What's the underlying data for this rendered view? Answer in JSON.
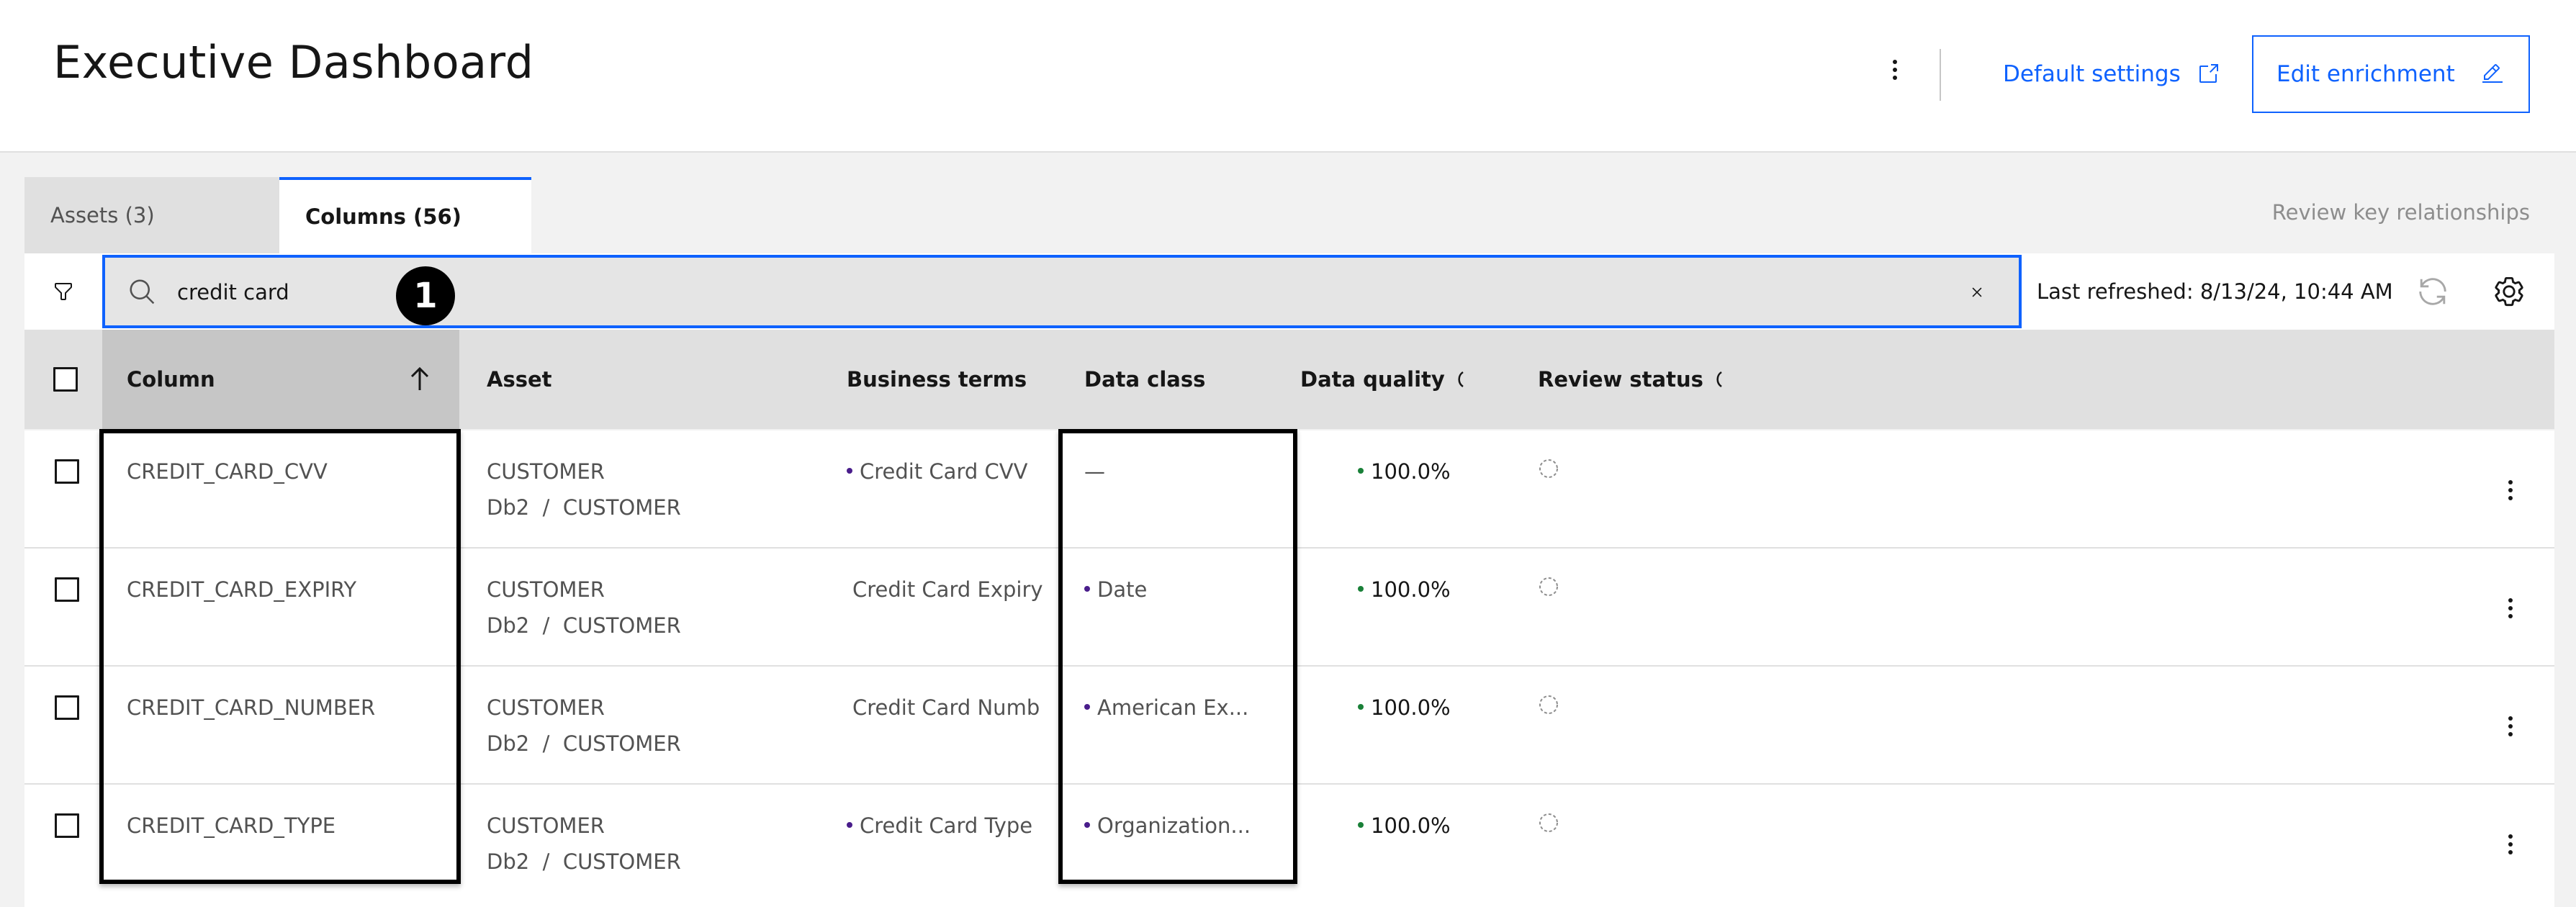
{
  "header": {
    "title": "Executive Dashboard",
    "default_settings_label": "Default settings",
    "edit_enrichment_label": "Edit enrichment"
  },
  "tabs": [
    {
      "label": "Assets (3)",
      "selected": false
    },
    {
      "label": "Columns (56)",
      "selected": true
    }
  ],
  "review_key_relationships": "Review key relationships",
  "toolbar": {
    "search_value": "credit card",
    "last_refreshed": "Last refreshed: 8/13/24, 10:44 AM"
  },
  "step_badge": "1",
  "table": {
    "headers": {
      "column": "Column",
      "asset": "Asset",
      "business_terms": "Business terms",
      "data_class": "Data class",
      "data_quality": "Data quality",
      "review_status": "Review status"
    },
    "rows": [
      {
        "column": "CREDIT_CARD_CVV",
        "asset_name": "CUSTOMER",
        "asset_path": "Db2  /  CUSTOMER",
        "business_term": "Credit Card CVV",
        "term_dot": true,
        "data_class": "—",
        "class_dot": false,
        "quality": "100.0%"
      },
      {
        "column": "CREDIT_CARD_EXPIRY",
        "asset_name": "CUSTOMER",
        "asset_path": "Db2  /  CUSTOMER",
        "business_term": "Credit Card Expiry",
        "term_dot": false,
        "data_class": "Date",
        "class_dot": true,
        "quality": "100.0%"
      },
      {
        "column": "CREDIT_CARD_NUMBER",
        "asset_name": "CUSTOMER",
        "asset_path": "Db2  /  CUSTOMER",
        "business_term": "Credit Card Numb",
        "term_dot": false,
        "data_class": "American Ex...",
        "class_dot": true,
        "quality": "100.0%"
      },
      {
        "column": "CREDIT_CARD_TYPE",
        "asset_name": "CUSTOMER",
        "asset_path": "Db2  /  CUSTOMER",
        "business_term": "Credit Card Type",
        "term_dot": true,
        "data_class": "Organization...",
        "class_dot": true,
        "quality": "100.0%"
      }
    ]
  },
  "colors": {
    "accent": "#0f62fe",
    "term_dot": "#491d8b",
    "quality_dot": "#198038"
  },
  "icons": [
    "overflow-menu-icon",
    "launch-icon",
    "edit-icon",
    "filter-icon",
    "search-icon",
    "close-icon",
    "refresh-icon",
    "settings-icon",
    "arrow-up-icon",
    "info-icon",
    "status-pending-icon"
  ]
}
